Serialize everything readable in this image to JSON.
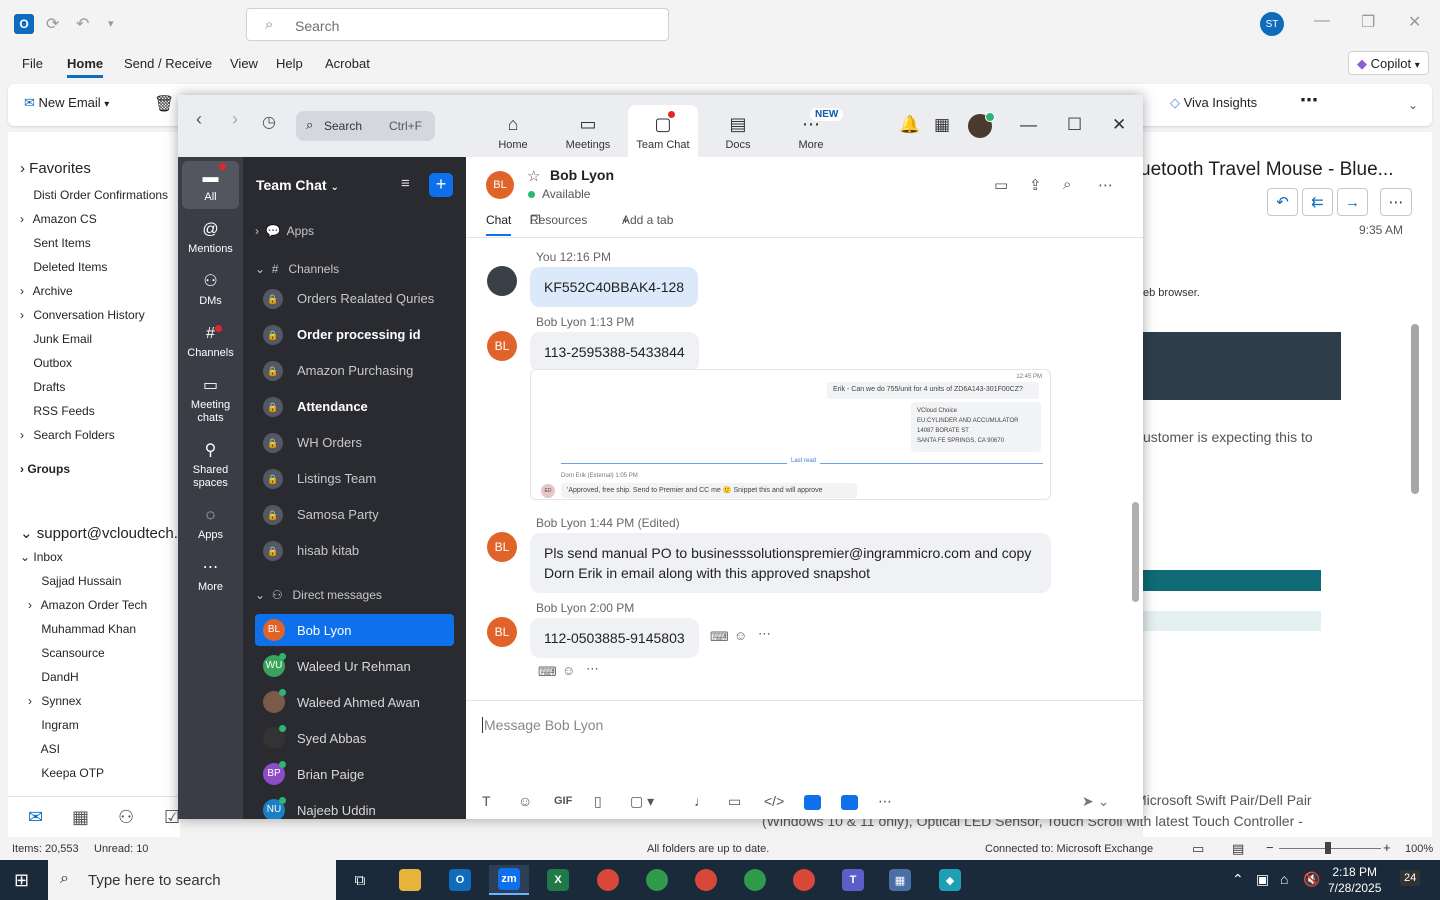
{
  "outlook": {
    "search_placeholder": "Search",
    "avatar": "ST",
    "menu": [
      "File",
      "Home",
      "Send / Receive",
      "View",
      "Help",
      "Acrobat"
    ],
    "copilot": "Copilot",
    "new_email": "New Email",
    "viva": "Viva Insights",
    "favorites": "Favorites",
    "folders": [
      {
        "label": "Disti Order Confirmations",
        "expand": ""
      },
      {
        "label": "Amazon CS",
        "expand": "›"
      },
      {
        "label": "Sent Items",
        "expand": ""
      },
      {
        "label": "Deleted Items",
        "expand": ""
      },
      {
        "label": "Archive",
        "expand": "›"
      },
      {
        "label": "Conversation History",
        "expand": "›"
      },
      {
        "label": "Junk Email",
        "expand": ""
      },
      {
        "label": "Outbox",
        "expand": ""
      },
      {
        "label": "Drafts",
        "expand": ""
      },
      {
        "label": "RSS Feeds",
        "expand": ""
      },
      {
        "label": "Search Folders",
        "expand": "›"
      }
    ],
    "groups": "Groups",
    "account": "support@vcloudtech.c",
    "inbox": "Inbox",
    "inbox_folders": [
      {
        "label": "Sajjad Hussain",
        "expand": ""
      },
      {
        "label": "Amazon Order Tech",
        "expand": "›"
      },
      {
        "label": "Muhammad Khan",
        "expand": ""
      },
      {
        "label": "Scansource",
        "expand": ""
      },
      {
        "label": "DandH",
        "expand": ""
      },
      {
        "label": "Synnex",
        "expand": "›"
      },
      {
        "label": "Ingram",
        "expand": ""
      },
      {
        "label": "ASI",
        "expand": ""
      },
      {
        "label": "Keepa OTP",
        "expand": ""
      }
    ],
    "reading": {
      "subject": "uetooth Travel Mouse - Blue...",
      "time": "9:35 AM",
      "web": "eb browser.",
      "customer": "ustomer is expecting this to",
      "bottom1": "Microsoft Swift Pair/Dell Pair",
      "bottom2": "(Windows 10 & 11 only), Optical LED Sensor, Touch Scroll with latest Touch Controller -"
    },
    "status": {
      "items": "Items: 20,553",
      "unread": "Unread: 10",
      "sync": "All folders are up to date.",
      "connection": "Connected to: Microsoft Exchange",
      "zoom": "100%"
    }
  },
  "taskbar": {
    "search_placeholder": "Type here to search",
    "time": "2:18 PM",
    "date": "7/28/2025",
    "notifications": "24"
  },
  "zoom": {
    "search_label": "Search",
    "search_shortcut": "Ctrl+F",
    "top_tabs": [
      {
        "label": "Home",
        "icon": "home-icon"
      },
      {
        "label": "Meetings",
        "icon": "video-icon"
      },
      {
        "label": "Team Chat",
        "icon": "chat-icon"
      },
      {
        "label": "Docs",
        "icon": "docs-icon"
      },
      {
        "label": "More",
        "icon": "more-icon"
      }
    ],
    "new_badge": "NEW",
    "rail": [
      {
        "label": "All"
      },
      {
        "label": "Mentions"
      },
      {
        "label": "DMs"
      },
      {
        "label": "Channels"
      },
      {
        "label": "Meeting chats"
      },
      {
        "label": "Shared spaces"
      },
      {
        "label": "Apps"
      },
      {
        "label": "More"
      }
    ],
    "sidebar_title": "Team Chat",
    "apps_section": "Apps",
    "channels_section": "Channels",
    "channels": [
      {
        "label": "Orders Realated Quries",
        "bold": false
      },
      {
        "label": "Order processing id",
        "bold": true
      },
      {
        "label": "Amazon Purchasing",
        "bold": false
      },
      {
        "label": "Attendance",
        "bold": true
      },
      {
        "label": "WH Orders",
        "bold": false
      },
      {
        "label": "Listings Team",
        "bold": false
      },
      {
        "label": "Samosa Party",
        "bold": false
      },
      {
        "label": "hisab kitab",
        "bold": false
      }
    ],
    "dm_section": "Direct messages",
    "dms": [
      {
        "label": "Bob Lyon",
        "initials": "BL",
        "color": "#e0642a"
      },
      {
        "label": "Waleed Ur Rehman",
        "initials": "WU",
        "color": "#3aa35b"
      },
      {
        "label": "Waleed Ahmed Awan",
        "initials": "",
        "color": "#7a5a4a"
      },
      {
        "label": "Syed Abbas",
        "initials": "",
        "color": "#333333"
      },
      {
        "label": "Brian Paige",
        "initials": "BP",
        "color": "#8e4cc4"
      },
      {
        "label": "Najeeb Uddin",
        "initials": "NU",
        "color": "#1c7fc4"
      }
    ],
    "chat": {
      "contact_initials": "BL",
      "contact_name": "Bob Lyon",
      "contact_status": "Available",
      "tabs": [
        "Chat",
        "Resources",
        "Add a tab"
      ],
      "messages": [
        {
          "meta": "You 12:16 PM",
          "text": "KF552C40BBAK4-128"
        },
        {
          "meta": "Bob Lyon 1:13 PM",
          "text": "113-2595388-5433844"
        },
        {
          "meta": "Bob Lyon 1:44 PM (Edited)",
          "text": "Pls send manual PO to businesssolutionspremier@ingrammicro.com and copy Dorn Erik in email along with this approved snapshot"
        },
        {
          "meta": "Bob Lyon 2:00 PM",
          "text": "112-0503885-9145803"
        }
      ],
      "snapshot": {
        "time": "12:45 PM",
        "question": "Erik -  Can we do 755/unit for 4 units of ZD6A143-301F00CZ?",
        "addr1": "VCloud Choice",
        "addr2": "EU:CYLINDER AND ACCUMULATOR",
        "addr3": "14087 BORATE ST",
        "addr4": "SANTA FE SPRINGS, CA 90670",
        "last_read": "Last read",
        "from": "Dorn Erik (External)   1:05 PM",
        "ed": "ED",
        "reply": "'Approved, free ship.  Send to Premier and CC me 🙂  Snippet this and will approve"
      },
      "compose_placeholder": "Message Bob Lyon"
    }
  }
}
